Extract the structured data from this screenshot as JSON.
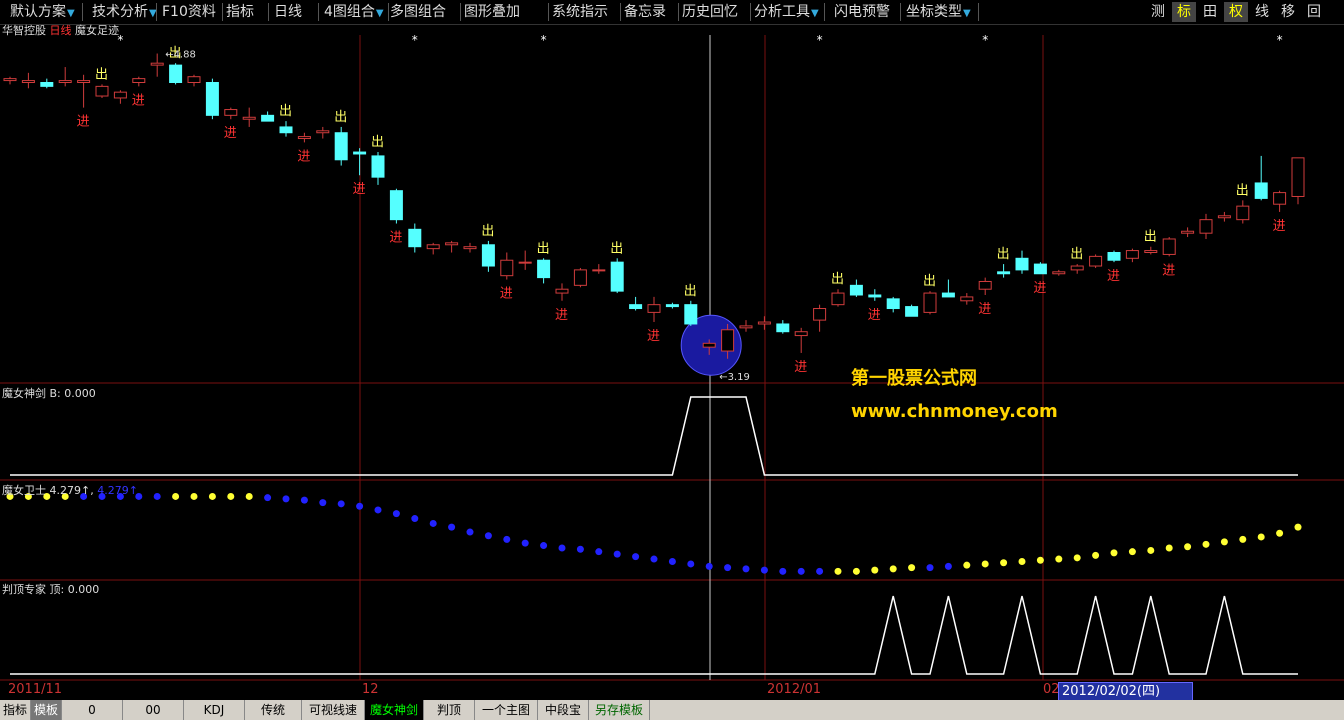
{
  "toolbar": {
    "items": [
      {
        "label": "默认方案",
        "dropdown": true
      },
      {
        "label": "技术分析",
        "dropdown": true
      },
      {
        "label": "F10资料",
        "dropdown": false
      },
      {
        "label": "指标",
        "dropdown": false
      },
      {
        "label": "日线",
        "dropdown": false
      },
      {
        "label": "4图组合",
        "dropdown": true
      },
      {
        "label": "多图组合",
        "dropdown": false
      },
      {
        "label": "图形叠加",
        "dropdown": false
      },
      {
        "label": "系统指示",
        "dropdown": false
      },
      {
        "label": "备忘录",
        "dropdown": false
      },
      {
        "label": "历史回忆",
        "dropdown": false
      },
      {
        "label": "分析工具",
        "dropdown": true
      },
      {
        "label": "闪电预警",
        "dropdown": false
      },
      {
        "label": "坐标类型",
        "dropdown": true
      }
    ],
    "right": [
      "测",
      "标",
      "田",
      "权",
      "线",
      "移",
      "回"
    ]
  },
  "main_panel": {
    "title_stock": "华智控股",
    "title_period": "日线",
    "title_indicator": "魔女足迹",
    "high_label": "4.88",
    "low_label": "3.19",
    "buy_mark": "进",
    "sell_mark": "出",
    "star_mark": "*"
  },
  "panel2": {
    "title": "魔女神剑",
    "value_label": "B: 0.000"
  },
  "panel3": {
    "title": "魔女卫士",
    "value1": "4.279↑,",
    "value2": "4.279↑"
  },
  "panel4": {
    "title": "判顶专家",
    "value_label": "顶: 0.000"
  },
  "watermark": {
    "line1": "第一股票公式网",
    "line2": "www.chnmoney.com"
  },
  "x_axis": {
    "labels": [
      "2011/11",
      "12",
      "2012/01",
      "02"
    ],
    "cursor_date": "2012/02/02(四)"
  },
  "bottom_tabs": [
    "指标",
    "模板",
    "0",
    "00",
    "KDJ",
    "传统",
    "可视线速",
    "魔女神剑",
    "判顶",
    "一个主图",
    "中段宝",
    "另存模板"
  ],
  "colors": {
    "up": "#d03c3c",
    "down": "#55ffff",
    "grid": "#7a1010",
    "signal_buy": "#ff3333",
    "signal_sell": "#ffff66"
  },
  "chart_data": {
    "type": "candlestick",
    "title": "",
    "candles": [
      [
        4.74,
        4.76,
        4.72,
        4.75
      ],
      [
        4.73,
        4.78,
        4.7,
        4.74
      ],
      [
        4.73,
        4.75,
        4.7,
        4.71
      ],
      [
        4.73,
        4.81,
        4.71,
        4.74
      ],
      [
        4.73,
        4.77,
        4.6,
        4.74
      ],
      [
        4.66,
        4.72,
        4.65,
        4.71
      ],
      [
        4.65,
        4.69,
        4.62,
        4.68
      ],
      [
        4.73,
        4.76,
        4.71,
        4.75
      ],
      [
        4.82,
        4.88,
        4.76,
        4.83
      ],
      [
        4.82,
        4.83,
        4.72,
        4.73
      ],
      [
        4.73,
        4.77,
        4.71,
        4.76
      ],
      [
        4.73,
        4.75,
        4.54,
        4.56
      ],
      [
        4.56,
        4.6,
        4.54,
        4.59
      ],
      [
        4.54,
        4.6,
        4.5,
        4.55
      ],
      [
        4.56,
        4.58,
        4.53,
        4.53
      ],
      [
        4.5,
        4.53,
        4.45,
        4.47
      ],
      [
        4.44,
        4.47,
        4.42,
        4.45
      ],
      [
        4.47,
        4.5,
        4.44,
        4.48
      ],
      [
        4.47,
        4.5,
        4.3,
        4.33
      ],
      [
        4.37,
        4.39,
        4.25,
        4.36
      ],
      [
        4.35,
        4.37,
        4.2,
        4.24
      ],
      [
        4.17,
        4.18,
        4.0,
        4.02
      ],
      [
        3.97,
        4.0,
        3.85,
        3.88
      ],
      [
        3.87,
        3.9,
        3.84,
        3.89
      ],
      [
        3.89,
        3.91,
        3.85,
        3.9
      ],
      [
        3.87,
        3.9,
        3.85,
        3.88
      ],
      [
        3.89,
        3.91,
        3.75,
        3.78
      ],
      [
        3.73,
        3.85,
        3.71,
        3.81
      ],
      [
        3.8,
        3.86,
        3.76,
        3.8
      ],
      [
        3.81,
        3.82,
        3.69,
        3.72
      ],
      [
        3.64,
        3.69,
        3.6,
        3.66
      ],
      [
        3.68,
        3.77,
        3.67,
        3.76
      ],
      [
        3.76,
        3.79,
        3.74,
        3.76
      ],
      [
        3.8,
        3.82,
        3.64,
        3.65
      ],
      [
        3.58,
        3.62,
        3.55,
        3.56
      ],
      [
        3.54,
        3.62,
        3.49,
        3.58
      ],
      [
        3.58,
        3.59,
        3.56,
        3.57
      ],
      [
        3.58,
        3.6,
        3.47,
        3.48
      ],
      [
        3.36,
        3.4,
        3.32,
        3.38
      ],
      [
        3.34,
        3.48,
        3.3,
        3.45
      ],
      [
        3.46,
        3.5,
        3.44,
        3.47
      ],
      [
        3.48,
        3.52,
        3.45,
        3.49
      ],
      [
        3.48,
        3.5,
        3.43,
        3.44
      ],
      [
        3.42,
        3.46,
        3.33,
        3.44
      ],
      [
        3.5,
        3.58,
        3.44,
        3.56
      ],
      [
        3.58,
        3.66,
        3.57,
        3.64
      ],
      [
        3.68,
        3.71,
        3.62,
        3.63
      ],
      [
        3.63,
        3.66,
        3.6,
        3.62
      ],
      [
        3.61,
        3.62,
        3.54,
        3.56
      ],
      [
        3.57,
        3.58,
        3.52,
        3.52
      ],
      [
        3.54,
        3.65,
        3.53,
        3.64
      ],
      [
        3.64,
        3.71,
        3.62,
        3.62
      ],
      [
        3.6,
        3.64,
        3.58,
        3.62
      ],
      [
        3.66,
        3.72,
        3.63,
        3.7
      ],
      [
        3.75,
        3.79,
        3.72,
        3.74
      ],
      [
        3.82,
        3.86,
        3.74,
        3.76
      ],
      [
        3.79,
        3.8,
        3.74,
        3.74
      ],
      [
        3.74,
        3.76,
        3.73,
        3.75
      ],
      [
        3.76,
        3.79,
        3.74,
        3.78
      ],
      [
        3.78,
        3.84,
        3.77,
        3.83
      ],
      [
        3.85,
        3.86,
        3.8,
        3.81
      ],
      [
        3.82,
        3.87,
        3.8,
        3.86
      ],
      [
        3.85,
        3.88,
        3.84,
        3.86
      ],
      [
        3.84,
        3.93,
        3.83,
        3.92
      ],
      [
        3.95,
        3.98,
        3.93,
        3.96
      ],
      [
        3.95,
        4.05,
        3.92,
        4.02
      ],
      [
        4.03,
        4.06,
        4.01,
        4.04
      ],
      [
        4.02,
        4.12,
        4.0,
        4.09
      ],
      [
        4.21,
        4.35,
        4.12,
        4.13
      ],
      [
        4.1,
        4.17,
        4.06,
        4.16
      ],
      [
        4.14,
        4.24,
        4.1,
        4.34
      ]
    ],
    "buy_signals": [
      4,
      7,
      12,
      16,
      19,
      21,
      27,
      30,
      35,
      43,
      47,
      53,
      56,
      60,
      63,
      69
    ],
    "sell_signals": [
      5,
      9,
      15,
      18,
      20,
      26,
      29,
      33,
      37,
      45,
      50,
      54,
      58,
      62,
      67
    ],
    "stars": [
      6,
      22,
      29,
      44,
      53,
      69
    ],
    "indicator_jian": [
      0,
      0,
      0,
      0,
      0,
      0,
      0,
      0,
      0,
      0,
      0,
      0,
      0,
      0,
      0,
      0,
      0,
      0,
      0,
      0,
      0,
      0,
      0,
      0,
      0,
      0,
      0,
      0,
      0,
      0,
      0,
      0,
      0,
      0,
      0,
      0,
      0,
      1,
      1,
      1,
      1,
      0,
      0,
      0,
      0,
      0,
      0,
      0,
      0,
      0,
      0,
      0,
      0,
      0,
      0,
      0,
      0,
      0,
      0,
      0,
      0,
      0,
      0,
      0,
      0,
      0,
      0,
      0,
      0,
      0,
      0
    ],
    "indicator_ding": [
      0,
      0,
      0,
      0,
      0,
      0,
      0,
      0,
      0,
      0,
      0,
      0,
      0,
      0,
      0,
      0,
      0,
      0,
      0,
      0,
      0,
      0,
      0,
      0,
      0,
      0,
      0,
      0,
      0,
      0,
      0,
      0,
      0,
      0,
      0,
      0,
      0,
      0,
      0,
      0,
      0,
      0,
      0,
      0,
      0,
      0,
      0,
      0,
      1,
      0,
      0,
      1,
      0,
      0,
      0,
      1,
      0,
      0,
      0,
      1,
      0,
      0,
      1,
      0,
      0,
      0,
      1,
      0,
      0,
      0,
      0
    ],
    "wei_shi": {
      "values": [
        4.28,
        4.28,
        4.28,
        4.28,
        4.28,
        4.28,
        4.28,
        4.28,
        4.28,
        4.28,
        4.28,
        4.28,
        4.28,
        4.28,
        4.27,
        4.26,
        4.25,
        4.23,
        4.22,
        4.2,
        4.17,
        4.14,
        4.1,
        4.06,
        4.03,
        3.99,
        3.96,
        3.93,
        3.9,
        3.88,
        3.86,
        3.85,
        3.83,
        3.81,
        3.79,
        3.77,
        3.75,
        3.73,
        3.71,
        3.7,
        3.69,
        3.68,
        3.67,
        3.67,
        3.67,
        3.67,
        3.67,
        3.68,
        3.69,
        3.7,
        3.7,
        3.71,
        3.72,
        3.73,
        3.74,
        3.75,
        3.76,
        3.77,
        3.78,
        3.8,
        3.82,
        3.83,
        3.84,
        3.86,
        3.87,
        3.89,
        3.91,
        3.93,
        3.95,
        3.98,
        4.03
      ],
      "color_flags": [
        1,
        1,
        1,
        1,
        0,
        0,
        0,
        0,
        0,
        1,
        1,
        1,
        1,
        1,
        0,
        0,
        0,
        0,
        0,
        0,
        0,
        0,
        0,
        0,
        0,
        0,
        0,
        0,
        0,
        0,
        0,
        0,
        0,
        0,
        0,
        0,
        0,
        0,
        0,
        0,
        0,
        0,
        0,
        0,
        0,
        1,
        1,
        1,
        1,
        1,
        0,
        0,
        1,
        1,
        1,
        1,
        1,
        1,
        1,
        1,
        1,
        1,
        1,
        1,
        1,
        1,
        1,
        1,
        1,
        1,
        1
      ]
    }
  }
}
